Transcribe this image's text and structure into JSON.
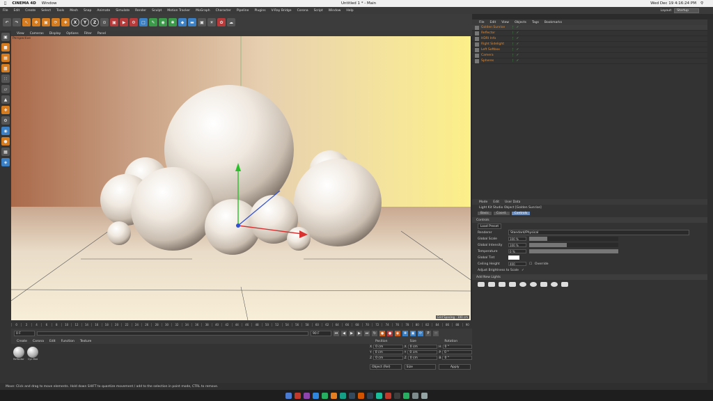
{
  "macbar": {
    "app": "CINEMA 4D",
    "menu": "Window",
    "title": "Untitled 1 * - Main",
    "clock": "Wed Dec 19  4:16:24 PM"
  },
  "menu": [
    "File",
    "Edit",
    "Create",
    "Select",
    "Tools",
    "Mesh",
    "Snap",
    "Animate",
    "Simulate",
    "Render",
    "Sculpt",
    "Motion Tracker",
    "MoGraph",
    "Character",
    "Pipeline",
    "Plugins",
    "V-Ray Bridge",
    "Corona",
    "Script",
    "Window",
    "Help"
  ],
  "layout": {
    "label": "Layout:",
    "value": "Startup"
  },
  "toolbar": {
    "x": "X",
    "y": "Y",
    "z": "Z"
  },
  "viewport": {
    "menu": [
      "View",
      "Cameras",
      "Display",
      "Options",
      "Filter",
      "Panel"
    ],
    "label": "Perspective",
    "status": "Grid Spacing : 100 cm"
  },
  "timeline": {
    "ticks": [
      "0",
      "2",
      "4",
      "6",
      "8",
      "10",
      "12",
      "14",
      "16",
      "18",
      "20",
      "22",
      "24",
      "26",
      "28",
      "30",
      "32",
      "34",
      "36",
      "38",
      "40",
      "42",
      "44",
      "46",
      "48",
      "50",
      "52",
      "54",
      "56",
      "58",
      "60",
      "62",
      "64",
      "66",
      "68",
      "70",
      "72",
      "74",
      "76",
      "78",
      "80",
      "82",
      "84",
      "86",
      "88",
      "90"
    ],
    "end": "0 F"
  },
  "transport": {
    "start": "0 F",
    "current": "90 F"
  },
  "materials": {
    "menu": [
      "Create",
      "Corona",
      "Edit",
      "Function",
      "Texture"
    ],
    "items": [
      "Reflector",
      "Cyc Mat"
    ]
  },
  "coords": {
    "headers": [
      "Position",
      "Size",
      "Rotation"
    ],
    "rows": [
      {
        "axis": "X",
        "pos": "0 cm",
        "size": "0 cm",
        "rot_axis": "H",
        "rot": "0 °"
      },
      {
        "axis": "Y",
        "pos": "0 cm",
        "size": "0 cm",
        "rot_axis": "P",
        "rot": "0 °"
      },
      {
        "axis": "Z",
        "pos": "0 cm",
        "size": "0 cm",
        "rot_axis": "B",
        "rot": "0 °"
      }
    ],
    "mode": "Object (Rel)",
    "size_mode": "Size",
    "apply": "Apply"
  },
  "objects": {
    "menu": [
      "File",
      "Edit",
      "View",
      "Objects",
      "Tags",
      "Bookmarks"
    ],
    "rows": [
      {
        "name": "Golden Sunrise",
        "orange": true
      },
      {
        "name": "Reflector",
        "orange": true
      },
      {
        "name": "HDRI Info",
        "orange": true
      },
      {
        "name": "Right Sidelight",
        "orange": true
      },
      {
        "name": "Left Softbox",
        "orange": true
      },
      {
        "name": "Camera",
        "orange": true
      },
      {
        "name": "Spheres",
        "orange": true
      }
    ]
  },
  "attributes": {
    "menu": [
      "Mode",
      "Edit",
      "User Data"
    ],
    "title": "Light Kit Studio Object [Golden Sunrise]",
    "tabs": [
      "Basic",
      "Coord.",
      "Controls"
    ],
    "section": "Controls",
    "load_preset": "Load Preset",
    "rows": [
      {
        "label": "Renderer",
        "value": "Standard/Physical"
      },
      {
        "label": "Global Scale",
        "value": "100 %",
        "fill": 0.2
      },
      {
        "label": "Global Intensity",
        "value": "100 %",
        "fill": 0.42
      },
      {
        "label": "Temperature",
        "value": "0 %",
        "fill": 1.0
      },
      {
        "label": "Global Tint",
        "value": ""
      },
      {
        "label": "Ceiling Height",
        "value": "400"
      },
      {
        "label": "Adjust Brightness to Scale",
        "value": ""
      }
    ],
    "override": "Override",
    "add_lights": "Add New Lights"
  },
  "status": "Move: Click and drag to move elements. Hold down SHIFT to quantize movement / add to the selection in point mode, CTRL to remove.",
  "colors": {
    "accent": "#e98a2c",
    "tab": "#6b8ec0"
  }
}
